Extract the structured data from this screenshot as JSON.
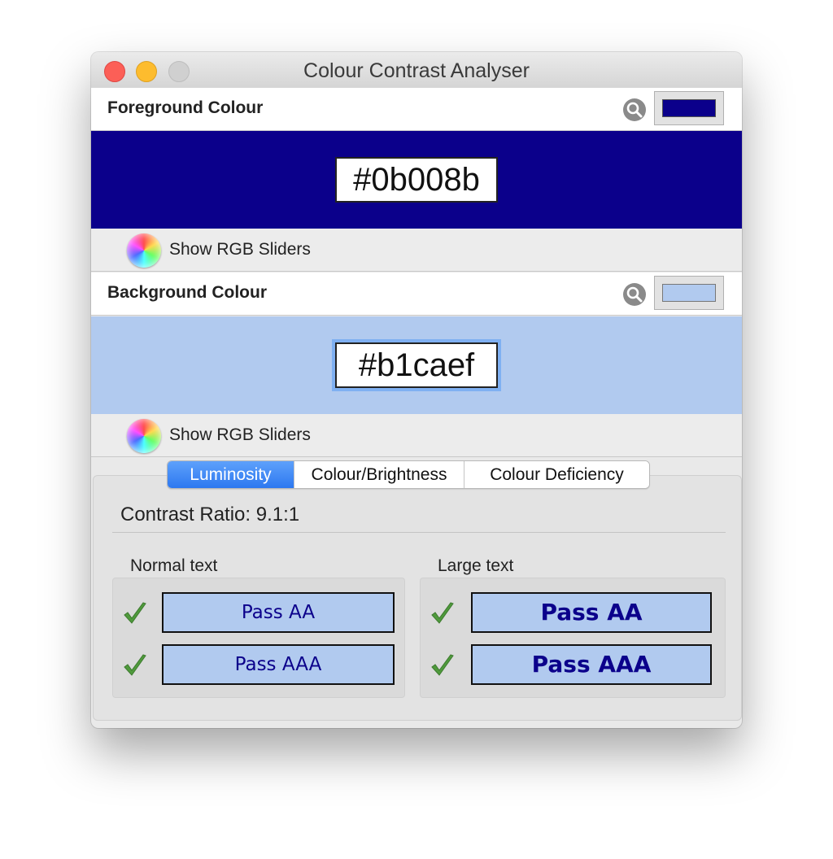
{
  "window": {
    "title": "Colour Contrast Analyser"
  },
  "foreground": {
    "label": "Foreground Colour",
    "hex": "#0b008b",
    "color": "#0b008b",
    "sliders_label": "Show RGB Sliders"
  },
  "background": {
    "label": "Background Colour",
    "hex": "#b1caef",
    "color": "#b1caef",
    "sliders_label": "Show RGB Sliders"
  },
  "tabs": [
    {
      "label": "Luminosity",
      "active": true
    },
    {
      "label": "Colour/Brightness",
      "active": false
    },
    {
      "label": "Colour Deficiency",
      "active": false
    }
  ],
  "contrast": {
    "ratio_text": "Contrast Ratio: 9.1:1"
  },
  "normal_text": {
    "label": "Normal text",
    "results": [
      "Pass AA",
      "Pass AAA"
    ]
  },
  "large_text": {
    "label": "Large text",
    "results": [
      "Pass AA",
      "Pass AAA"
    ]
  },
  "icons": {
    "picker": "magnifier-icon",
    "wheel": "colour-wheel-icon",
    "check": "checkmark-icon"
  }
}
